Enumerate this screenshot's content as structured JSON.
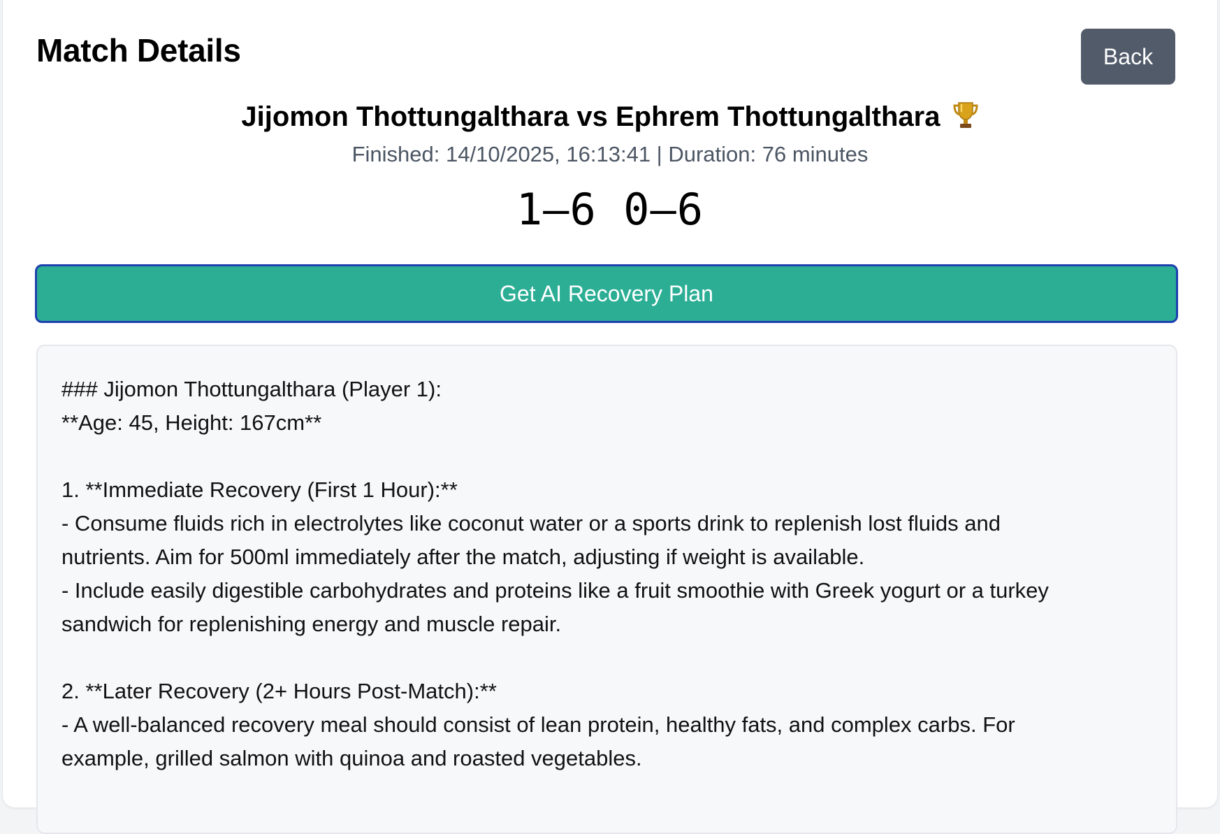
{
  "header": {
    "title": "Match Details",
    "back_label": "Back"
  },
  "match": {
    "title": "Jijomon Thottungalthara vs Ephrem Thottungalthara",
    "meta": "Finished: 14/10/2025, 16:13:41 | Duration: 76 minutes",
    "score": "1–6 0–6"
  },
  "ai_button": {
    "label": "Get AI Recovery Plan"
  },
  "plan": {
    "lines": [
      "### Jijomon Thottungalthara (Player 1):",
      "**Age: 45, Height: 167cm**",
      "",
      "1. **Immediate Recovery (First 1 Hour):**",
      "- Consume fluids rich in electrolytes like coconut water or a sports drink to replenish lost fluids and",
      "nutrients. Aim for 500ml immediately after the match, adjusting if weight is available.",
      "- Include easily digestible carbohydrates and proteins like a fruit smoothie with Greek yogurt or a turkey",
      "sandwich for replenishing energy and muscle repair.",
      "",
      "2. **Later Recovery (2+ Hours Post-Match):**",
      "- A well-balanced recovery meal should consist of lean protein, healthy fats, and complex carbs. For",
      "example, grilled salmon with quinoa and roasted vegetables."
    ]
  },
  "icons": {
    "trophy": "trophy-icon"
  },
  "colors": {
    "accent": "#2cae95",
    "button_border": "#1e40af",
    "back_button": "#525b6a"
  }
}
